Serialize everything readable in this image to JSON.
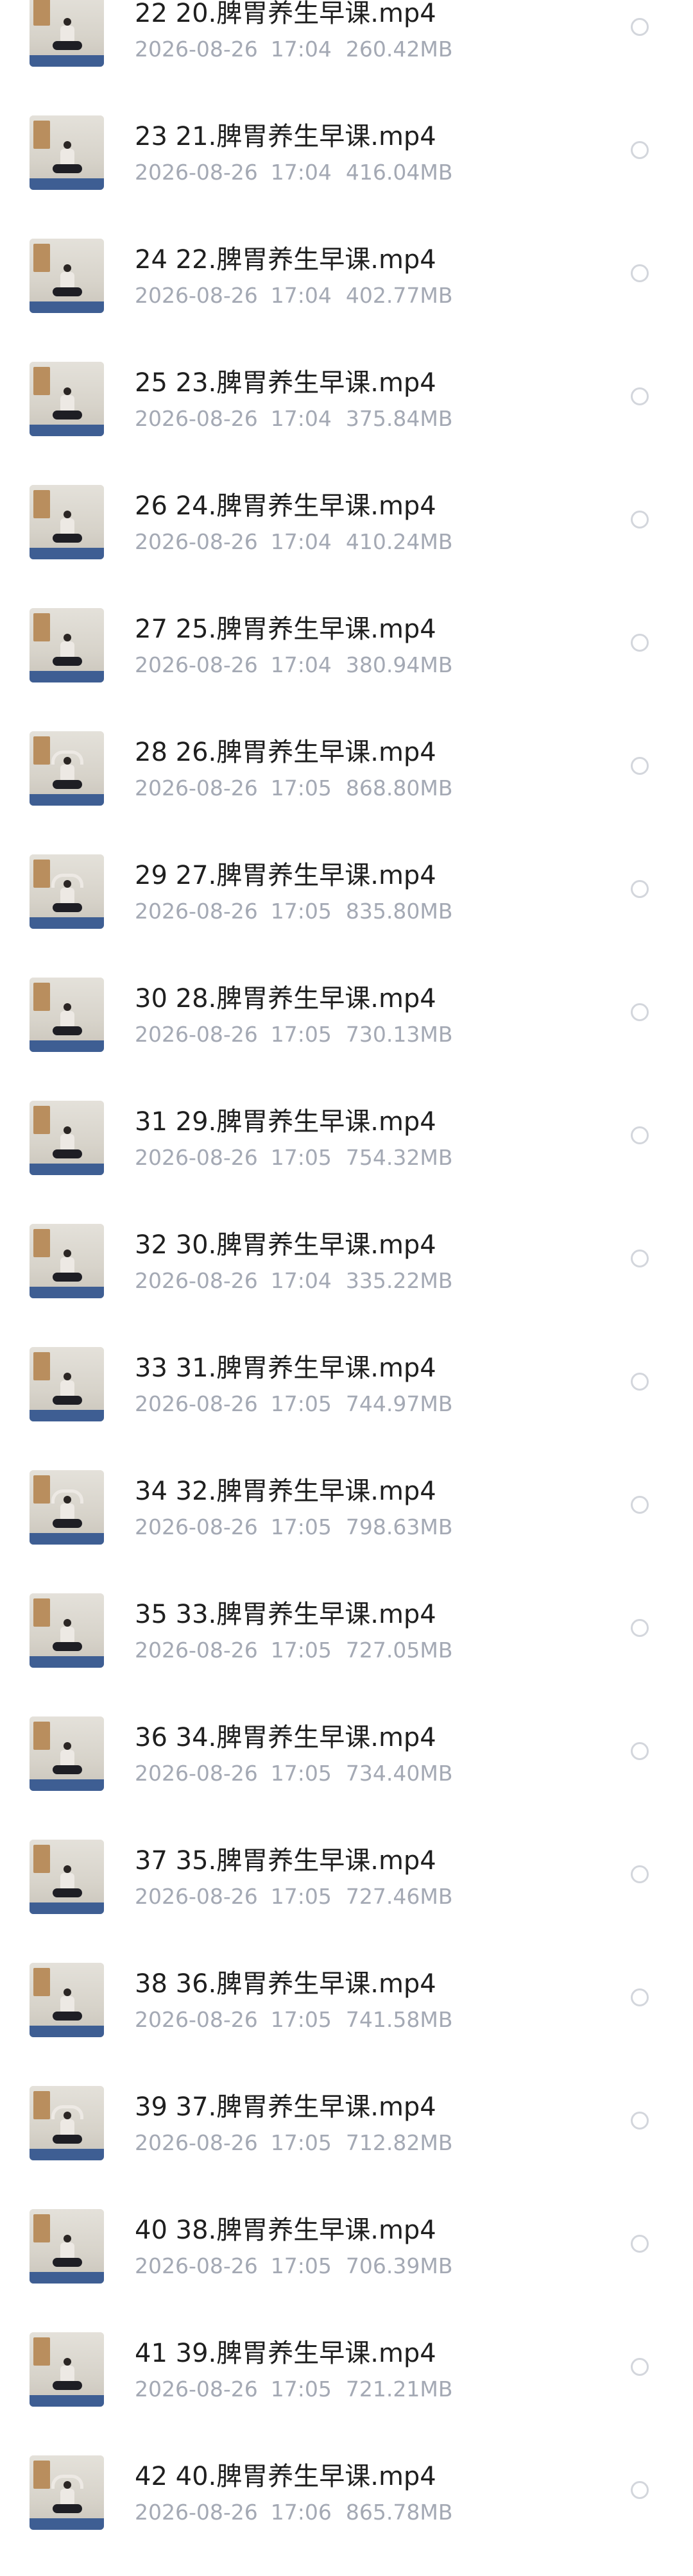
{
  "files": [
    {
      "name": "22 20.脾胃养生早课.mp4",
      "date": "2026-08-26",
      "time": "17:04",
      "size": "260.42MB",
      "thumb_icon": "video-thumbnail"
    },
    {
      "name": "23 21.脾胃养生早课.mp4",
      "date": "2026-08-26",
      "time": "17:04",
      "size": "416.04MB",
      "thumb_icon": "video-thumbnail"
    },
    {
      "name": "24 22.脾胃养生早课.mp4",
      "date": "2026-08-26",
      "time": "17:04",
      "size": "402.77MB",
      "thumb_icon": "video-thumbnail"
    },
    {
      "name": "25 23.脾胃养生早课.mp4",
      "date": "2026-08-26",
      "time": "17:04",
      "size": "375.84MB",
      "thumb_icon": "video-thumbnail"
    },
    {
      "name": "26 24.脾胃养生早课.mp4",
      "date": "2026-08-26",
      "time": "17:04",
      "size": "410.24MB",
      "thumb_icon": "video-thumbnail"
    },
    {
      "name": "27 25.脾胃养生早课.mp4",
      "date": "2026-08-26",
      "time": "17:04",
      "size": "380.94MB",
      "thumb_icon": "video-thumbnail"
    },
    {
      "name": "28 26.脾胃养生早课.mp4",
      "date": "2026-08-26",
      "time": "17:05",
      "size": "868.80MB",
      "thumb_icon": "video-thumbnail"
    },
    {
      "name": "29 27.脾胃养生早课.mp4",
      "date": "2026-08-26",
      "time": "17:05",
      "size": "835.80MB",
      "thumb_icon": "video-thumbnail"
    },
    {
      "name": "30 28.脾胃养生早课.mp4",
      "date": "2026-08-26",
      "time": "17:05",
      "size": "730.13MB",
      "thumb_icon": "video-thumbnail"
    },
    {
      "name": "31 29.脾胃养生早课.mp4",
      "date": "2026-08-26",
      "time": "17:05",
      "size": "754.32MB",
      "thumb_icon": "video-thumbnail"
    },
    {
      "name": "32 30.脾胃养生早课.mp4",
      "date": "2026-08-26",
      "time": "17:04",
      "size": "335.22MB",
      "thumb_icon": "video-thumbnail"
    },
    {
      "name": "33 31.脾胃养生早课.mp4",
      "date": "2026-08-26",
      "time": "17:05",
      "size": "744.97MB",
      "thumb_icon": "video-thumbnail"
    },
    {
      "name": "34 32.脾胃养生早课.mp4",
      "date": "2026-08-26",
      "time": "17:05",
      "size": "798.63MB",
      "thumb_icon": "video-thumbnail"
    },
    {
      "name": "35 33.脾胃养生早课.mp4",
      "date": "2026-08-26",
      "time": "17:05",
      "size": "727.05MB",
      "thumb_icon": "video-thumbnail"
    },
    {
      "name": "36 34.脾胃养生早课.mp4",
      "date": "2026-08-26",
      "time": "17:05",
      "size": "734.40MB",
      "thumb_icon": "video-thumbnail"
    },
    {
      "name": "37 35.脾胃养生早课.mp4",
      "date": "2026-08-26",
      "time": "17:05",
      "size": "727.46MB",
      "thumb_icon": "video-thumbnail"
    },
    {
      "name": "38 36.脾胃养生早课.mp4",
      "date": "2026-08-26",
      "time": "17:05",
      "size": "741.58MB",
      "thumb_icon": "video-thumbnail"
    },
    {
      "name": "39 37.脾胃养生早课.mp4",
      "date": "2026-08-26",
      "time": "17:05",
      "size": "712.82MB",
      "thumb_icon": "video-thumbnail"
    },
    {
      "name": "40 38.脾胃养生早课.mp4",
      "date": "2026-08-26",
      "time": "17:05",
      "size": "706.39MB",
      "thumb_icon": "video-thumbnail"
    },
    {
      "name": "41 39.脾胃养生早课.mp4",
      "date": "2026-08-26",
      "time": "17:05",
      "size": "721.21MB",
      "thumb_icon": "video-thumbnail"
    },
    {
      "name": "42 40.脾胃养生早课.mp4",
      "date": "2026-08-26",
      "time": "17:06",
      "size": "865.78MB",
      "thumb_icon": "video-thumbnail"
    }
  ],
  "colors": {
    "title": "#1f1f1f",
    "meta": "#a4a9b4",
    "radio_border": "#d3d6dc",
    "background": "#ffffff"
  }
}
